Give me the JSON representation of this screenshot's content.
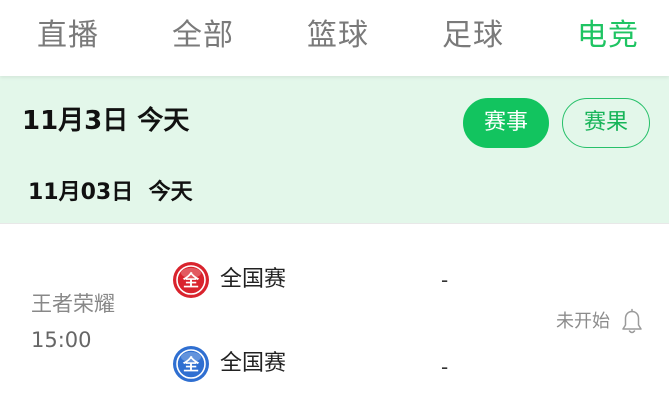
{
  "tabs": [
    {
      "label": "直播"
    },
    {
      "label": "全部"
    },
    {
      "label": "篮球"
    },
    {
      "label": "足球"
    },
    {
      "label": "电竞",
      "active": true
    }
  ],
  "date_header": {
    "date": "11月3日",
    "day": "今天",
    "sub_date": "11月03日",
    "sub_day": "今天"
  },
  "buttons": {
    "events": "赛事",
    "results": "赛果"
  },
  "match": {
    "game": "王者荣耀",
    "time": "15:00",
    "team_a": {
      "name": "全国赛",
      "logo_color": "#d9232d",
      "score": "-"
    },
    "team_b": {
      "name": "全国赛",
      "logo_color": "#2f6fd1",
      "score": "-"
    },
    "status": "未开始"
  },
  "colors": {
    "accent": "#1fc463",
    "date_bar_bg": "#e3f7ea",
    "muted_text": "#888888"
  }
}
